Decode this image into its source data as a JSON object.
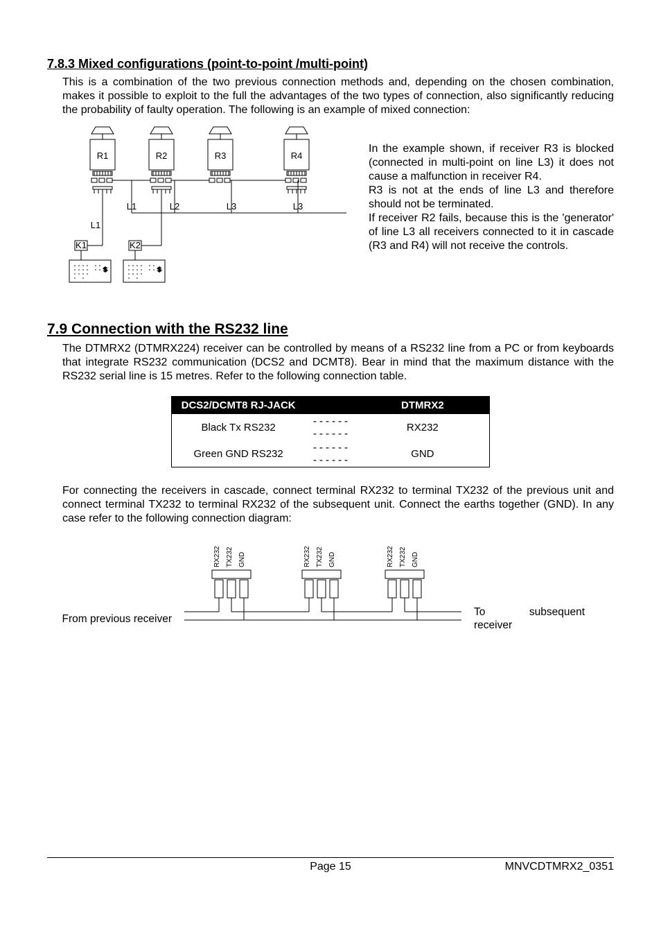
{
  "section_783": {
    "heading": "7.8.3 Mixed configurations (point-to-point /multi-point)",
    "paragraph": "This is a combination of the two previous connection methods and, depending on the chosen combination, makes it possible to exploit to the full the advantages of the two types of connection, also significantly reducing the probability of faulty operation. The following is an example of mixed connection:",
    "example_paragraph": "In the example shown, if receiver R3 is blocked (connected in multi-point on line L3) it does not cause a malfunction in receiver R4.\nR3 is not at the ends of line L3 and therefore should not be terminated.\nIf receiver R2 fails, because this is the 'generator' of line L3 all receivers connected to it in cascade (R3 and R4) will not receive the controls."
  },
  "diagram1_labels": {
    "R1": "R1",
    "R2": "R2",
    "R3": "R3",
    "R4": "R4",
    "L1a": "L1",
    "L1b": "L1",
    "L2": "L2",
    "L3a": "L3",
    "L3b": "L3",
    "K1": "K1",
    "K2": "K2"
  },
  "section_79": {
    "heading": "7.9 Connection with the RS232 line",
    "paragraph1": "The DTMRX2 (DTMRX224) receiver can be controlled by means of a RS232 line from a PC or from keyboards that integrate RS232 communication (DCS2 and DCMT8). Bear in mind that the maximum distance with the RS232 serial line is 15 metres. Refer to the following connection table.",
    "paragraph2": "For connecting the receivers in cascade, connect terminal RX232 to terminal TX232 of the previous unit and connect terminal TX232 to terminal RX232 of the subsequent unit. Connect the earths together (GND). In any case refer to the following connection diagram:"
  },
  "conn_table": {
    "header1": "DCS2/DCMT8 RJ-JACK",
    "header2": "DTMRX2",
    "rows": [
      {
        "left": "Black Tx RS232",
        "sep": "------------",
        "right": "RX232"
      },
      {
        "left": "Green GND RS232",
        "sep": "------------",
        "right": "GND"
      }
    ]
  },
  "fig2": {
    "left_label": "From previous receiver",
    "right_label": "To subsequent receiver",
    "pin_labels": [
      "RX232",
      "TX232",
      "GND"
    ]
  },
  "footer": {
    "center": "Page 15",
    "right": "MNVCDTMRX2_0351"
  }
}
